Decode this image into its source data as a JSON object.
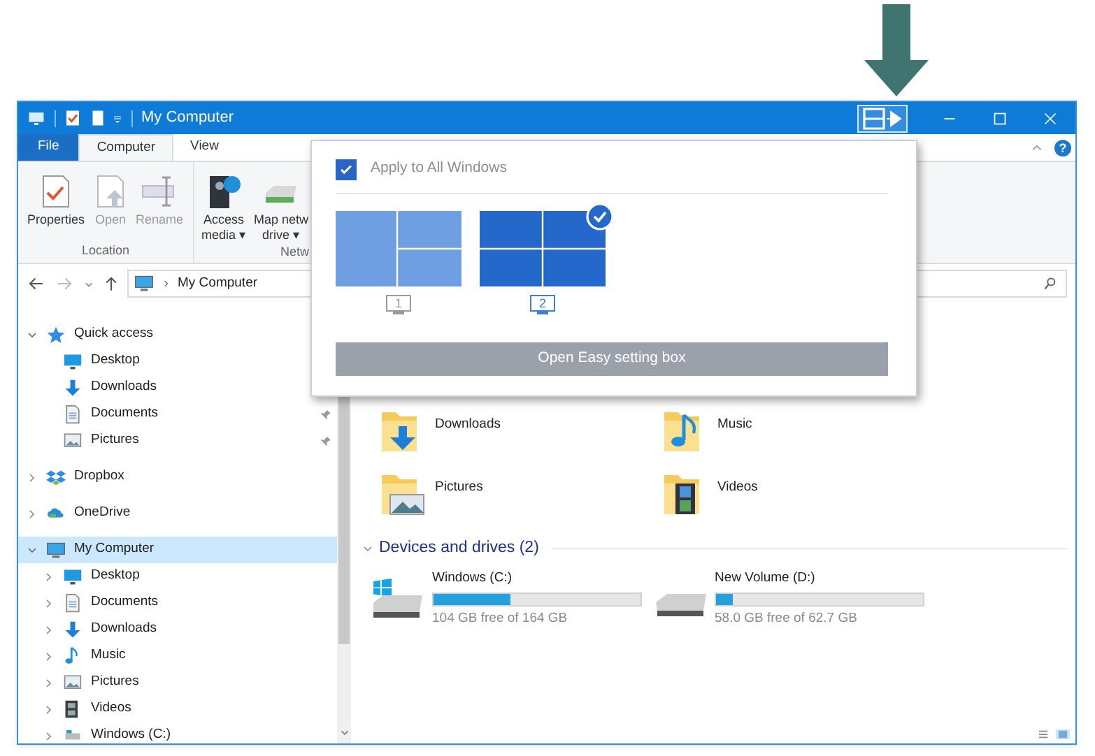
{
  "window": {
    "title": "My Computer",
    "help": "?"
  },
  "ribbon_tabs": [
    {
      "label": "File",
      "kind": "file",
      "selected": false
    },
    {
      "label": "Computer",
      "kind": "tab",
      "selected": true
    },
    {
      "label": "View",
      "kind": "tab",
      "selected": false
    }
  ],
  "ribbon": {
    "buttons": [
      {
        "kind": "properties",
        "lines": [
          "Properties"
        ],
        "disabled": false
      },
      {
        "kind": "open",
        "lines": [
          "Open"
        ],
        "disabled": true
      },
      {
        "kind": "rename",
        "lines": [
          "Rename"
        ],
        "disabled": true
      },
      {
        "kind": "media",
        "lines": [
          "Access",
          "media ▾"
        ],
        "disabled": false
      },
      {
        "kind": "network-drive",
        "lines": [
          "Map netw",
          "drive ▾"
        ],
        "disabled": false
      }
    ],
    "groups": [
      "Location",
      "Netw"
    ]
  },
  "address": {
    "path": "My Computer"
  },
  "navigation": [
    {
      "name": "Quick access",
      "kind": "quick",
      "expanded": true,
      "selected": false,
      "children": [
        {
          "name": "Desktop",
          "kind": "desktop",
          "pinned": false
        },
        {
          "name": "Downloads",
          "kind": "downloads",
          "pinned": false
        },
        {
          "name": "Documents",
          "kind": "documents",
          "pinned": true
        },
        {
          "name": "Pictures",
          "kind": "pictures",
          "pinned": true
        }
      ]
    },
    {
      "name": "Dropbox",
      "kind": "dropbox",
      "expanded": false,
      "selected": false
    },
    {
      "name": "OneDrive",
      "kind": "onedrive",
      "expanded": false,
      "selected": false
    },
    {
      "name": "My Computer",
      "kind": "computer",
      "expanded": true,
      "selected": true,
      "children": [
        {
          "name": "Desktop",
          "kind": "desktop",
          "expanded": false
        },
        {
          "name": "Documents",
          "kind": "documents",
          "expanded": false
        },
        {
          "name": "Downloads",
          "kind": "downloads",
          "expanded": false
        },
        {
          "name": "Music",
          "kind": "music",
          "expanded": false
        },
        {
          "name": "Pictures",
          "kind": "pictures",
          "expanded": false
        },
        {
          "name": "Videos",
          "kind": "videos",
          "expanded": false
        },
        {
          "name": "Windows (C:)",
          "kind": "drive",
          "expanded": false
        }
      ]
    }
  ],
  "folders": [
    {
      "name": "Downloads",
      "kind": "downloads"
    },
    {
      "name": "Music",
      "kind": "music"
    },
    {
      "name": "Pictures",
      "kind": "pictures"
    },
    {
      "name": "Videos",
      "kind": "videos"
    }
  ],
  "drives_section": {
    "title": "Devices and drives (2)",
    "expanded": true
  },
  "drives": [
    {
      "name": "Windows (C:)",
      "kind": "system",
      "level": 0.37,
      "free": "104 GB free of 164 GB"
    },
    {
      "name": "New Volume (D:)",
      "kind": "plain",
      "level": 0.08,
      "free": "58.0 GB free of 62.7 GB"
    }
  ],
  "popup": {
    "apply_all": {
      "label": "Apply to All Windows",
      "checked": true
    },
    "layouts": [
      {
        "kind": "three",
        "monitor": "1",
        "selected": false
      },
      {
        "kind": "four",
        "monitor": "2",
        "selected": true
      }
    ],
    "button": "Open Easy setting box"
  }
}
